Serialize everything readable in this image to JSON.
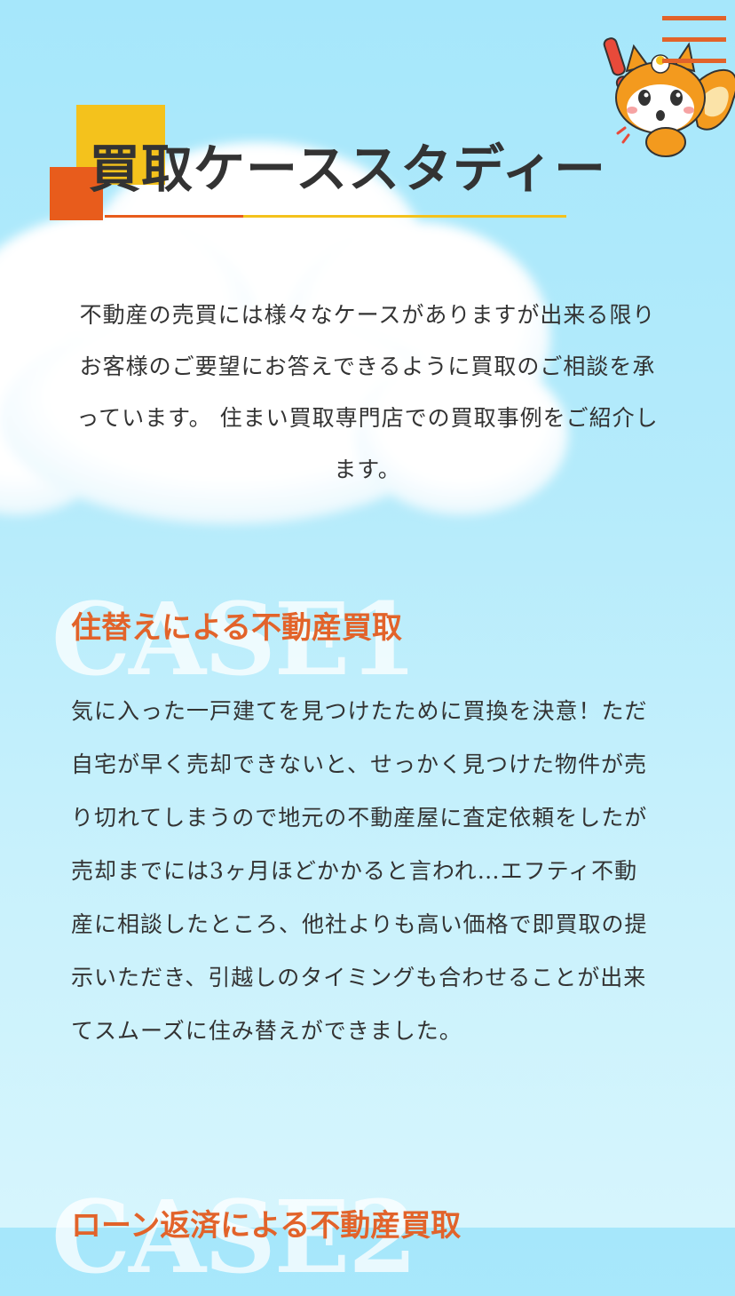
{
  "header": {
    "menu_icon": "hamburger-icon",
    "mascot_icon": "squirrel-mascot-icon",
    "accent_color": "#e2632a"
  },
  "section": {
    "title": "買取ケーススタディー",
    "intro": "不動産の売買には様々なケースがありますが出来る限り お客様のご要望にお答えできるように買取のご相談を承っています。 住まい買取専門店での買取事例をご紹介します。"
  },
  "cases": [
    {
      "label": "CASE1",
      "title": "住替えによる不動産買取",
      "body": "気に入った一戸建てを見つけたために買換を決意！ただ自宅が早く売却できないと、せっかく見つけた物件が売り切れてしまうので地元の不動産屋に査定依頼をしたが売却までには3ヶ月ほどかかると言われ…エフティ不動産に相談したところ、他社よりも高い価格で即買取の提示いただき、引越しのタイミングも合わせることが出来てスムーズに住み替えができました。"
    },
    {
      "label": "CASE2",
      "title": "ローン返済による不動産買取"
    }
  ]
}
